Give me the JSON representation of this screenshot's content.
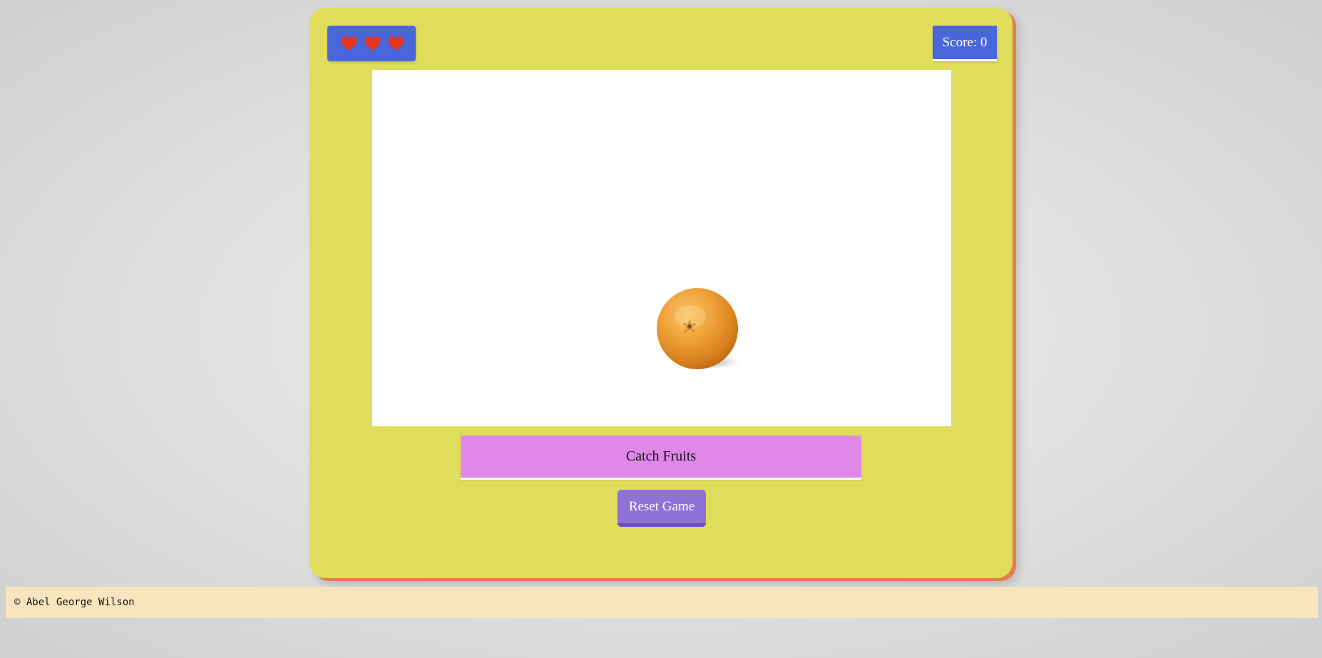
{
  "hud": {
    "lives": 3,
    "heart_icon": "heart-icon",
    "heart_color": "#e8361c",
    "score_label": "Score: 0"
  },
  "play_area": {
    "fruit_icon": "orange-fruit-icon"
  },
  "game_title": "Catch Fruits",
  "controls": {
    "reset_label": "Reset Game"
  },
  "footer": {
    "copyright": "© Abel George Wilson"
  },
  "colors": {
    "card": "#dfdd5b",
    "card_shadow": "#ea7a50",
    "hud_blue": "#4a66db",
    "title_pink": "#e088e8",
    "button_purple": "#8e72d8",
    "footer_bg": "#f9e4bd"
  }
}
